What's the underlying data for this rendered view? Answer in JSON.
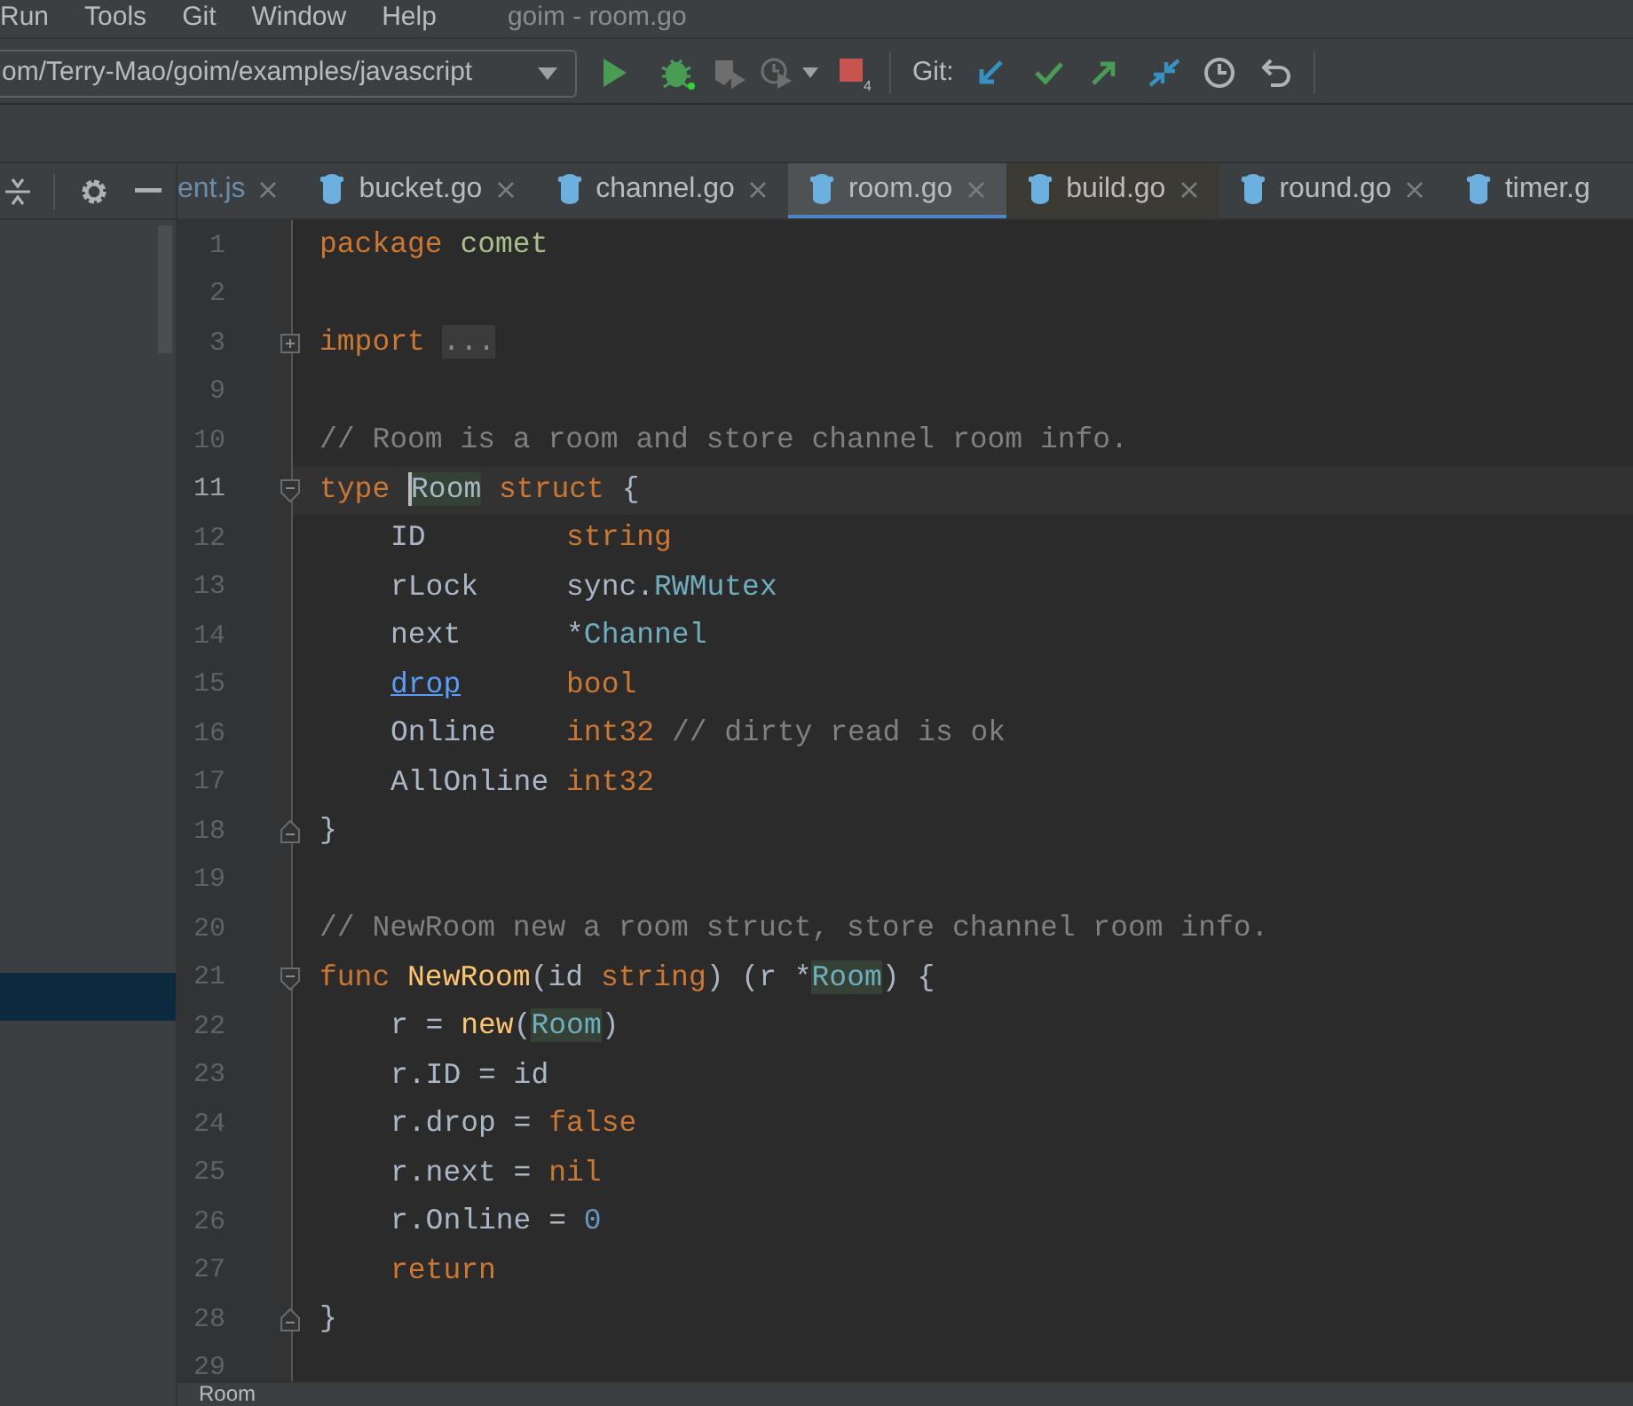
{
  "menu": [
    {
      "label": "Run"
    },
    {
      "label": "Tools"
    },
    {
      "label": "Git"
    },
    {
      "label": "Window"
    },
    {
      "label": "Help"
    }
  ],
  "window": {
    "title": "goim - room.go"
  },
  "toolbar": {
    "run_config": "om/Terry-Mao/goim/examples/javascript",
    "stop_badge": "4",
    "git_label": "Git:"
  },
  "tabs": [
    {
      "label": "ent.js",
      "selected": false,
      "kind": "js"
    },
    {
      "label": "bucket.go",
      "selected": false,
      "kind": "go"
    },
    {
      "label": "channel.go",
      "selected": false,
      "kind": "go"
    },
    {
      "label": "room.go",
      "selected": true,
      "kind": "go"
    },
    {
      "label": "build.go",
      "selected": false,
      "kind": "go"
    },
    {
      "label": "round.go",
      "selected": false,
      "kind": "go"
    },
    {
      "label": "timer.g",
      "selected": false,
      "kind": "go"
    }
  ],
  "editor": {
    "lines": [
      {
        "number": "1",
        "current": false,
        "tokens": [
          {
            "kind": "keyword",
            "text": "package "
          },
          {
            "kind": "package",
            "text": "comet"
          }
        ]
      },
      {
        "number": "2",
        "current": false
      },
      {
        "number": "3",
        "current": false,
        "fold_marker": {
          "kind": "collapsed"
        },
        "tokens": [
          {
            "kind": "keyword",
            "text": "import "
          },
          {
            "kind": "folded",
            "text": "..."
          }
        ]
      },
      {
        "number": "9",
        "current": false
      },
      {
        "number": "10",
        "current": false,
        "tokens": [
          {
            "kind": "comment",
            "text": "// Room is a room and store channel room info."
          }
        ]
      },
      {
        "number": "11",
        "current": true,
        "fold_marker": {
          "kind": "start"
        },
        "tokens": [
          {
            "kind": "keyword",
            "text": "type "
          },
          {
            "kind": "plain",
            "text": "Room",
            "highlight": true,
            "caret": true
          },
          {
            "kind": "keyword",
            "text": " struct"
          },
          {
            "kind": "plain",
            "text": " {"
          }
        ]
      },
      {
        "number": "12",
        "current": false,
        "indented": true,
        "tokens": [
          {
            "kind": "plain",
            "text": "ID        "
          },
          {
            "kind": "keyword",
            "text": "string"
          }
        ]
      },
      {
        "number": "13",
        "current": false,
        "indented": true,
        "tokens": [
          {
            "kind": "plain",
            "text": "rLock     sync."
          },
          {
            "kind": "type",
            "text": "RWMutex"
          }
        ]
      },
      {
        "number": "14",
        "current": false,
        "indented": true,
        "tokens": [
          {
            "kind": "plain",
            "text": "next      *"
          },
          {
            "kind": "type",
            "text": "Channel"
          }
        ]
      },
      {
        "number": "15",
        "current": false,
        "indented": true,
        "tokens": [
          {
            "kind": "link",
            "text": "drop"
          },
          {
            "kind": "keyword",
            "text": "      bool"
          }
        ]
      },
      {
        "number": "16",
        "current": false,
        "indented": true,
        "tokens": [
          {
            "kind": "plain",
            "text": "Online    "
          },
          {
            "kind": "keyword",
            "text": "int32"
          },
          {
            "kind": "comment",
            "text": " // dirty read is ok"
          }
        ]
      },
      {
        "number": "17",
        "current": false,
        "indented": true,
        "tokens": [
          {
            "kind": "plain",
            "text": "AllOnline "
          },
          {
            "kind": "keyword",
            "text": "int32"
          }
        ]
      },
      {
        "number": "18",
        "current": false,
        "fold_marker": {
          "kind": "end"
        },
        "tokens": [
          {
            "kind": "plain",
            "text": "}"
          }
        ]
      },
      {
        "number": "19",
        "current": false
      },
      {
        "number": "20",
        "current": false,
        "tokens": [
          {
            "kind": "comment",
            "text": "// NewRoom new a room struct, store channel room info."
          }
        ]
      },
      {
        "number": "21",
        "current": false,
        "fold_marker": {
          "kind": "start"
        },
        "tokens": [
          {
            "kind": "keyword",
            "text": "func "
          },
          {
            "kind": "function",
            "text": "NewRoom"
          },
          {
            "kind": "plain",
            "text": "(id "
          },
          {
            "kind": "keyword",
            "text": "string"
          },
          {
            "kind": "plain",
            "text": ") (r *"
          },
          {
            "kind": "type",
            "text": "Room",
            "highlight": true
          },
          {
            "kind": "plain",
            "text": ") {"
          }
        ]
      },
      {
        "number": "22",
        "current": false,
        "indented": true,
        "tokens": [
          {
            "kind": "plain",
            "text": "r = "
          },
          {
            "kind": "function",
            "text": "new"
          },
          {
            "kind": "plain",
            "text": "("
          },
          {
            "kind": "type",
            "text": "Room",
            "highlight": true
          },
          {
            "kind": "plain",
            "text": ")"
          }
        ]
      },
      {
        "number": "23",
        "current": false,
        "indented": true,
        "tokens": [
          {
            "kind": "plain",
            "text": "r.ID = id"
          }
        ]
      },
      {
        "number": "24",
        "current": false,
        "indented": true,
        "tokens": [
          {
            "kind": "plain",
            "text": "r.drop = "
          },
          {
            "kind": "keyword",
            "text": "false"
          }
        ]
      },
      {
        "number": "25",
        "current": false,
        "indented": true,
        "tokens": [
          {
            "kind": "plain",
            "text": "r.next = "
          },
          {
            "kind": "keyword",
            "text": "nil"
          }
        ]
      },
      {
        "number": "26",
        "current": false,
        "indented": true,
        "tokens": [
          {
            "kind": "plain",
            "text": "r.Online = "
          },
          {
            "kind": "number",
            "text": "0"
          }
        ]
      },
      {
        "number": "27",
        "current": false,
        "indented": true,
        "tokens": [
          {
            "kind": "keyword",
            "text": "return"
          }
        ]
      },
      {
        "number": "28",
        "current": false,
        "fold_marker": {
          "kind": "end"
        },
        "tokens": [
          {
            "kind": "plain",
            "text": "}"
          }
        ]
      },
      {
        "number": "29",
        "current": false
      }
    ]
  },
  "breadcrumb": "Room"
}
